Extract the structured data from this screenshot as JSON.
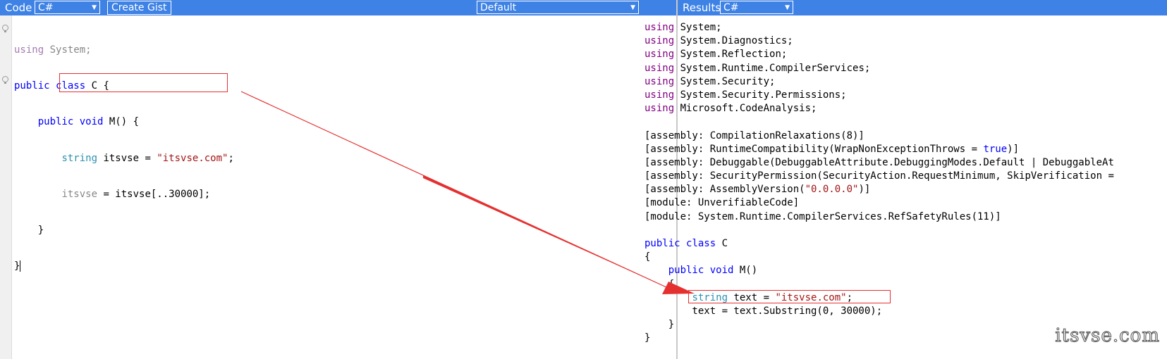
{
  "left_toolbar": {
    "label": "Code",
    "language_select": "C#",
    "gist_button": "Create Gist",
    "mode_select": "Default"
  },
  "right_toolbar": {
    "label": "Results",
    "language_select": "C#"
  },
  "source_lines": [
    "using System;",
    "public class C {",
    "    public void M() {",
    "        string itsvse = \"itsvse.com\";",
    "        itsvse = itsvse[..30000];",
    "    }",
    "}"
  ],
  "result_lines": [
    "using System;",
    "using System.Diagnostics;",
    "using System.Reflection;",
    "using System.Runtime.CompilerServices;",
    "using System.Security;",
    "using System.Security.Permissions;",
    "using Microsoft.CodeAnalysis;",
    "",
    "[assembly: CompilationRelaxations(8)]",
    "[assembly: RuntimeCompatibility(WrapNonExceptionThrows = true)]",
    "[assembly: Debuggable(DebuggableAttribute.DebuggingModes.Default | DebuggableAt",
    "[assembly: SecurityPermission(SecurityAction.RequestMinimum, SkipVerification =",
    "[assembly: AssemblyVersion(\"0.0.0.0\")]",
    "[module: UnverifiableCode]",
    "[module: System.Runtime.CompilerServices.RefSafetyRules(11)]",
    "",
    "public class C",
    "{",
    "    public void M()",
    "    {",
    "        string text = \"itsvse.com\";",
    "        text = text.Substring(0, 30000);",
    "    }",
    "}"
  ],
  "watermark": "itsvse.com",
  "colors": {
    "toolbar": "#3e82e5",
    "keyword": "#0000ff",
    "using_keyword": "#800080",
    "type": "#2b91af",
    "string": "#a31515",
    "highlight_box": "#e53030",
    "arrow": "#e53030"
  }
}
